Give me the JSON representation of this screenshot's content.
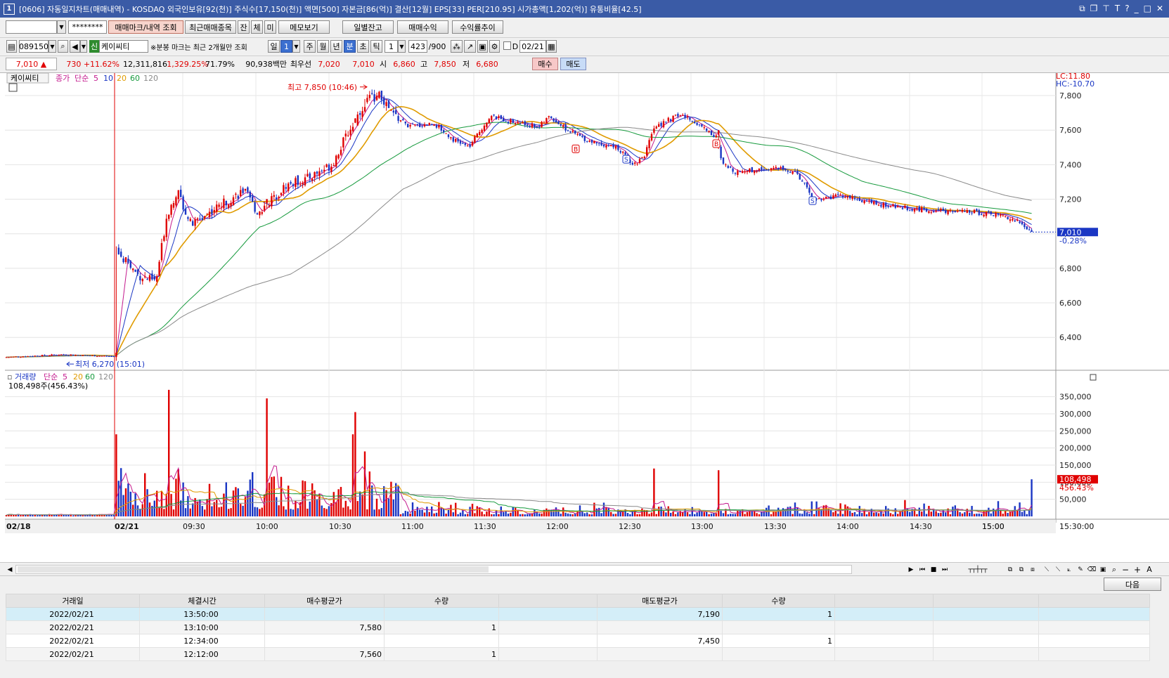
{
  "title": {
    "icon": "1",
    "text": "[0606] 자동일지차트(매매내역) - KOSDAQ 외국인보유[92(천)] 주식수[17,150(천)] 액면[500] 자본금[86(억)] 결산[12월] EPS[33] PER[210.95] 시가총액[1,202(억)] 유통비율[42.5]"
  },
  "toolbar1": {
    "account_value": "",
    "password_value": "********",
    "btn_mark": "매매마크/내역 조회",
    "btn_recent": "최근매매종목",
    "btn_jan": "잔",
    "btn_che": "체",
    "btn_mi": "미",
    "btn_memo": "메모보기",
    "btn_daily": "일별잔고",
    "btn_profit": "매매수익",
    "btn_trend": "수익률추이"
  },
  "toolbar2": {
    "code": "089150",
    "sin": "신",
    "stock_name": "케이씨티",
    "note": "※분봉 마크는 최근 2개월만 조회",
    "periods": [
      "일",
      "1",
      "주",
      "월",
      "년",
      "분",
      "초",
      "틱"
    ],
    "interval": "1",
    "count": "423",
    "count_total": "/900",
    "d_label": "D",
    "date": "02/21"
  },
  "quote": {
    "price": "7,010",
    "arrow": "▲",
    "change": "730",
    "change_pct": "+11.62%",
    "volume": "12,311,816",
    "vol_ratio": "1,329.25%",
    "turnover": "71.79%",
    "amount": "90,938백만",
    "best_ask_lbl": "최우선",
    "best_ask": "7,020",
    "best_bid": "7,010",
    "open_lbl": "시",
    "open": "6,860",
    "high_lbl": "고",
    "high": "7,850",
    "low_lbl": "저",
    "low": "6,680",
    "buy_btn": "매수",
    "sell_btn": "매도"
  },
  "price_panel": {
    "name": "케이씨티",
    "legend": [
      "종가",
      "단순",
      "5",
      "10",
      "20",
      "60",
      "120"
    ],
    "high_ann": "최고 7,850 (10:46)",
    "low_ann": "최저 6,270 (15:01)",
    "lc": "LC:11.80",
    "hc": "HC:-10.70",
    "current": "7,010",
    "current_pct": "-0.28%",
    "yticks": [
      "7,800",
      "7,600",
      "7,400",
      "7,200",
      "7,000",
      "6,800",
      "6,600",
      "6,400"
    ],
    "marks": [
      "B",
      "S",
      "S",
      "B",
      "S"
    ]
  },
  "volume_panel": {
    "legend": [
      "거래량",
      "단순",
      "5",
      "20",
      "60",
      "120"
    ],
    "info": "108,498주(456.43%)",
    "yticks": [
      "350,000",
      "300,000",
      "250,000",
      "200,000",
      "150,000",
      "100,000",
      "50,000"
    ],
    "current": "108,498",
    "current_pct": "456.43%"
  },
  "xaxis": {
    "ticks": [
      "02/18",
      "15:00",
      "02/21",
      "09:30",
      "10:00",
      "10:30",
      "11:00",
      "11:30",
      "12:00",
      "12:30",
      "13:00",
      "13:30",
      "14:00",
      "14:30",
      "15:00",
      "15:30:00"
    ]
  },
  "chart_data": {
    "type": "candlestick",
    "title": "",
    "ylim": [
      6230,
      7910
    ],
    "series": [
      {
        "name": "종가",
        "values_key": "bars"
      },
      {
        "name": "5"
      },
      {
        "name": "10"
      },
      {
        "name": "20"
      },
      {
        "name": "60"
      },
      {
        "name": "120"
      }
    ],
    "high": 7850,
    "high_time": "10:46",
    "low": 6270,
    "low_time": "15:01",
    "last": 7010,
    "volume_ylim": [
      0,
      380000
    ],
    "last_volume": 108498
  },
  "table": {
    "next_btn": "다음",
    "headers": [
      "거래일",
      "체결시간",
      "매수평균가",
      "수량",
      "",
      "매도평균가",
      "수량",
      "",
      "",
      ""
    ],
    "rows": [
      {
        "date": "2022/02/21",
        "time": "13:50:00",
        "buy": "",
        "bqty": "",
        "sell": "7,190",
        "sqty": "1"
      },
      {
        "date": "2022/02/21",
        "time": "13:10:00",
        "buy": "7,580",
        "bqty": "1",
        "sell": "",
        "sqty": ""
      },
      {
        "date": "2022/02/21",
        "time": "12:34:00",
        "buy": "",
        "bqty": "",
        "sell": "7,450",
        "sqty": "1"
      },
      {
        "date": "2022/02/21",
        "time": "12:12:00",
        "buy": "7,560",
        "bqty": "1",
        "sell": "",
        "sqty": ""
      }
    ]
  }
}
